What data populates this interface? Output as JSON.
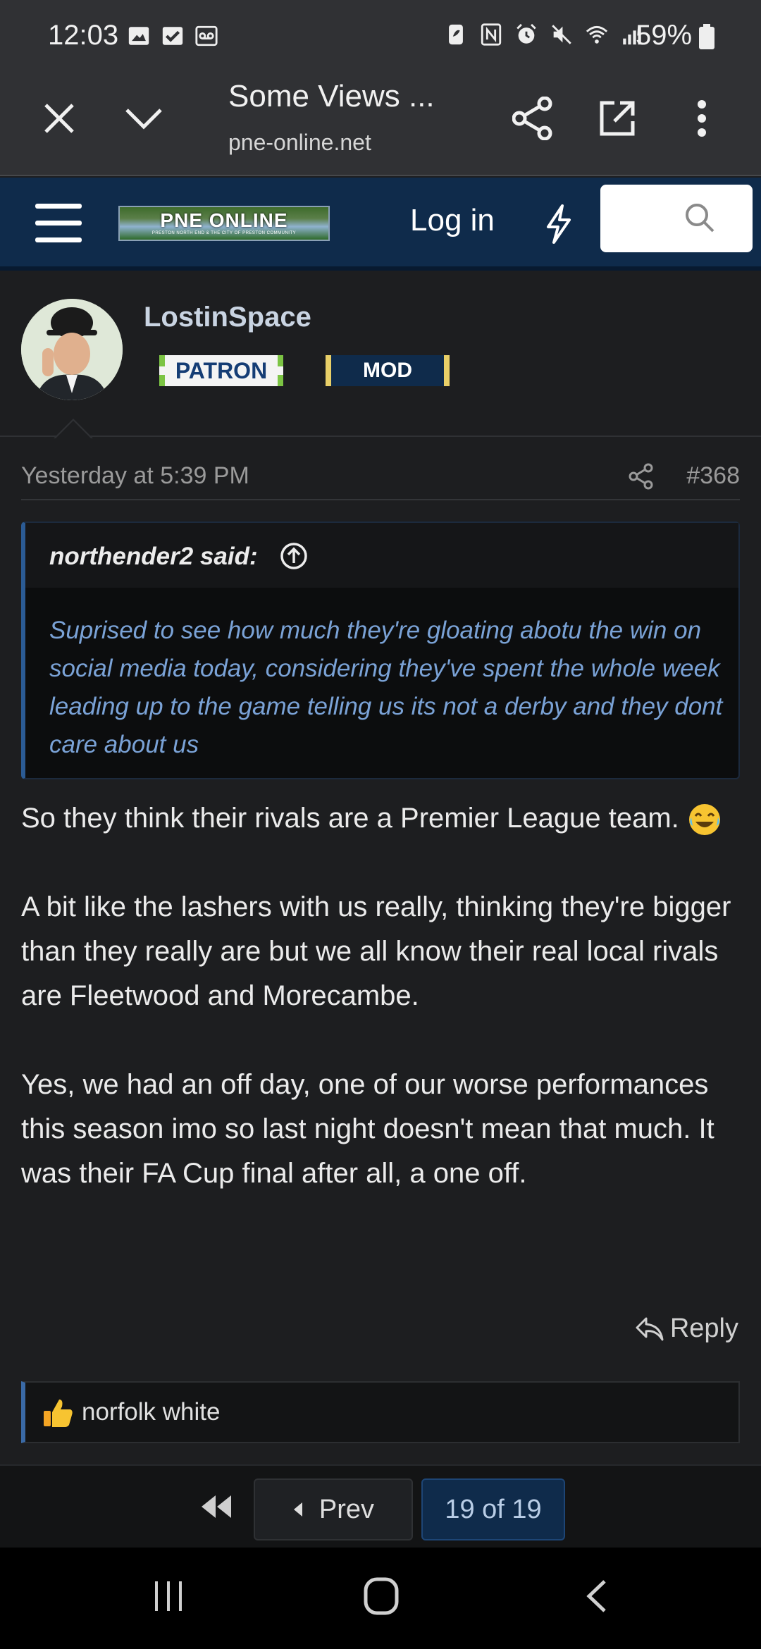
{
  "status_bar": {
    "time": "12:03",
    "battery": "59%",
    "left_icons": [
      "gallery-icon",
      "check-icon",
      "voicemail-icon"
    ],
    "right_icons": [
      "battery-saver-icon",
      "nfc-icon",
      "alarm-icon",
      "mute-icon",
      "wifi-icon",
      "signal-icon"
    ]
  },
  "browser_tab": {
    "title": "Some Views ...",
    "url": "pne-online.net"
  },
  "site_header": {
    "logo_text": "PNE ONLINE",
    "logo_subtext": "PRESTON NORTH END & THE CITY OF PRESTON COMMUNITY",
    "login": "Log in"
  },
  "post": {
    "author": "LostinSpace",
    "badges": {
      "patron": "PATRON",
      "mod": "MOD"
    },
    "date": "Yesterday at 5:39 PM",
    "number": "#368",
    "quote": {
      "author": "northender2 said:",
      "text": "Suprised to see how much they're gloating abotu the win on social media today, considering they've spent the whole week leading up to the game telling us its not a derby and they dont care about us"
    },
    "paragraphs": [
      "So they think their rivals are a Premier League team.",
      "A bit like the lashers with us really, thinking they're bigger than they really are but we all know their real local rivals are Fleetwood and Morecambe.",
      "Yes, we had an off day, one of our worse performances this season imo so last night doesn't mean that much. It was their FA Cup final after all, a one off."
    ],
    "reply": "Reply",
    "reaction_user": "norfolk white"
  },
  "pagination": {
    "prev": "Prev",
    "current": "19 of 19"
  },
  "colors": {
    "header_bg": "#0f2b4b",
    "page_bg": "#1d1e20",
    "quote_text": "#7aa2d6",
    "badge_green": "#7cc444",
    "badge_gold": "#e8cf68"
  }
}
